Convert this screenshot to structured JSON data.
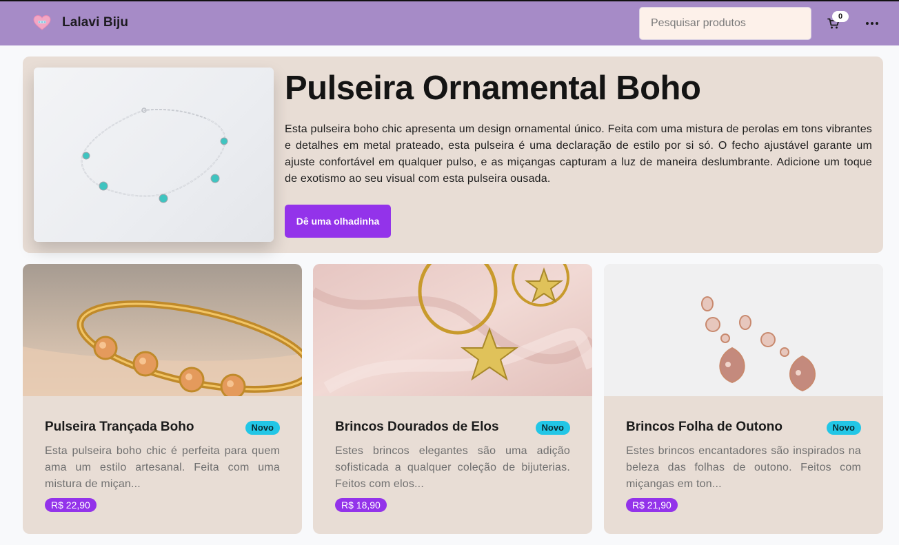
{
  "app": {
    "brand_name": "Lalavi Biju",
    "brand_color": "#a68bc7",
    "accent_color": "#9333ea",
    "badge_color": "#22c6e6"
  },
  "nav": {
    "search_placeholder": "Pesquisar produtos",
    "cart_count": "0",
    "cart_icon": "cart-icon",
    "more_icon": "more-icon"
  },
  "hero": {
    "title": "Pulseira Ornamental Boho",
    "description": "Esta pulseira boho chic apresenta um design ornamental único. Feita com uma mistura de perolas em tons vibrantes e detalhes em metal prateado, esta pulseira é uma declaração de estilo por si só. O fecho ajustável garante um ajuste confortável em qualquer pulso, e as miçangas capturam a luz de maneira deslumbrante. Adicione um toque de exotismo ao seu visual com esta pulseira ousada.",
    "button_label": "Dê uma olhadinha"
  },
  "products": [
    {
      "title": "Pulseira Trançada Boho",
      "badge": "Novo",
      "description": "Esta pulseira boho chic é perfeita para quem ama um estilo artesanal. Feita com uma mistura de miçan...",
      "price": "R$ 22,90"
    },
    {
      "title": "Brincos Dourados de Elos",
      "badge": "Novo",
      "description": "Estes brincos elegantes são uma adição sofisticada a qualquer coleção de bijuterias. Feitos com elos...",
      "price": "R$ 18,90"
    },
    {
      "title": "Brincos Folha de Outono",
      "badge": "Novo",
      "description": "Estes brincos encantadores são inspirados na beleza das folhas de outono. Feitos com miçangas em ton...",
      "price": "R$ 21,90"
    }
  ]
}
